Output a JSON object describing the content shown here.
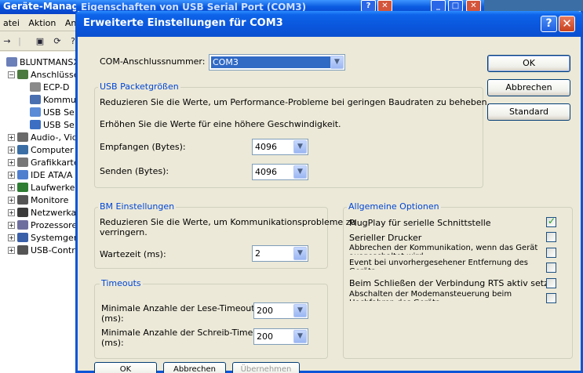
{
  "devmgr": {
    "title": "Geräte-Manager",
    "menu": [
      "atei",
      "Aktion",
      "An"
    ],
    "tree": [
      {
        "label": "BLUNTMANSXS",
        "level": 0,
        "expander": ""
      },
      {
        "label": "Anschlüsse",
        "level": 1,
        "expander": "−"
      },
      {
        "label": "ECP-D",
        "level": 2,
        "expander": ""
      },
      {
        "label": "Kommu",
        "level": 2,
        "expander": ""
      },
      {
        "label": "USB Se",
        "level": 2,
        "expander": ""
      },
      {
        "label": "USB Se",
        "level": 2,
        "expander": ""
      },
      {
        "label": "Audio-, Vid",
        "level": 1,
        "expander": "+"
      },
      {
        "label": "Computer",
        "level": 1,
        "expander": "+"
      },
      {
        "label": "Grafikkarte",
        "level": 1,
        "expander": "+"
      },
      {
        "label": "IDE ATA/A",
        "level": 1,
        "expander": "+"
      },
      {
        "label": "Laufwerke",
        "level": 1,
        "expander": "+"
      },
      {
        "label": "Monitore",
        "level": 1,
        "expander": "+"
      },
      {
        "label": "Netzwerka",
        "level": 1,
        "expander": "+"
      },
      {
        "label": "Prozessore",
        "level": 1,
        "expander": "+"
      },
      {
        "label": "Systemger",
        "level": 1,
        "expander": "+"
      },
      {
        "label": "USB-Contr",
        "level": 1,
        "expander": "+"
      }
    ]
  },
  "props": {
    "title": "Eigenschaften von USB Serial Port (COM3)"
  },
  "dialog": {
    "title": "Erweiterte Einstellungen für COM3",
    "com_label": "COM-Anschlussnummer:",
    "com_value": "COM3",
    "buttons": {
      "ok": "OK",
      "cancel": "Abbrechen",
      "default": "Standard"
    },
    "usb": {
      "title": "USB Packetgrößen",
      "text1": "Reduzieren Sie die Werte, um Performance-Probleme bei geringen Baudraten zu beheben.",
      "text2": "Erhöhen Sie die Werte für eine höhere Geschwindigkeit.",
      "receive_label": "Empfangen (Bytes):",
      "receive_value": "4096",
      "send_label": "Senden (Bytes):",
      "send_value": "4096"
    },
    "bm": {
      "title": "BM Einstellungen",
      "text_line1": "Reduzieren Sie die Werte, um Kommunikationsprobleme zu",
      "text_line2": "verringern.",
      "latency_label": "Wartezeit (ms):",
      "latency_value": "2"
    },
    "timeouts": {
      "title": "Timeouts",
      "read_label_1": "Minimale Anzahle der Lese-Timeouts",
      "read_label_2": "(ms):",
      "read_value": "200",
      "write_label_1": "Minimale Anzahle der Schreib-Timeouts",
      "write_label_2": "(ms):",
      "write_value": "200"
    },
    "general": {
      "title": "Allgemeine Optionen",
      "options": [
        {
          "label": "PlugPlay für serielle Schnittstelle",
          "checked": true
        },
        {
          "label": "Serieller Drucker",
          "checked": false
        },
        {
          "label": "Abbrechen der Kommunikation, wenn das Gerät ausgeschaltet wird",
          "checked": false
        },
        {
          "label": "Event bei unvorhergesehener Entfernung des Geräts",
          "checked": false
        },
        {
          "label": "Beim Schließen der Verbindung RTS aktiv setzen",
          "checked": false
        },
        {
          "label": "Abschalten der Modemansteuerung beim Hochfahren des Geräts",
          "checked": false
        }
      ]
    },
    "behind_buttons": [
      "OK",
      "Abbrechen",
      "Übernehmen"
    ]
  }
}
